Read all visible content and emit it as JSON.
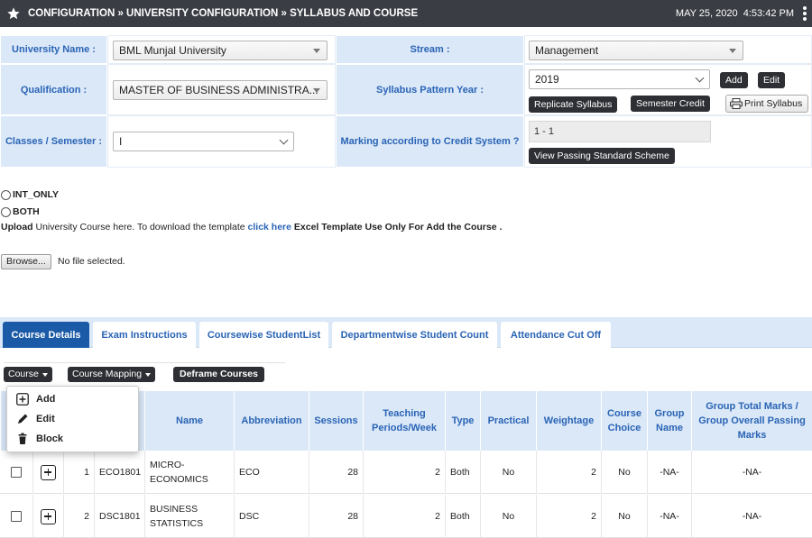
{
  "header": {
    "breadcrumb": "CONFIGURATION » UNIVERSITY CONFIGURATION » SYLLABUS AND COURSE",
    "date": "MAY 25, 2020",
    "time": "4:53:42 PM",
    "star_icon": "star-icon",
    "menu_icon": "kebab-menu-icon"
  },
  "form": {
    "university_label": "University Name :",
    "university_value": "BML Munjal University",
    "stream_label": "Stream :",
    "stream_value": "Management",
    "qualification_label": "Qualification :",
    "qualification_value": "MASTER OF BUSINESS ADMINISTRA...",
    "syllabus_year_label": "Syllabus Pattern Year :",
    "syllabus_year_value": "2019",
    "add_label": "Add",
    "edit_label": "Edit",
    "replicate_label": "Replicate Syllabus",
    "semester_credit_label": "Semester Credit",
    "print_label": "Print Syllabus",
    "classes_label": "Classes / Semester :",
    "classes_value": "I",
    "marking_label": "Marking according to Credit System ?",
    "marking_value": "1 - 1",
    "passing_label": "View Passing Standard Scheme"
  },
  "options": {
    "int_only": "INT_ONLY",
    "both": "BOTH",
    "upload_bold": "Upload",
    "upload_text": " University Course here. To download the template ",
    "click_here": "click here",
    "template_note": " Excel Template Use Only For Add the Course .",
    "browse_label": "Browse...",
    "no_file": "No file selected."
  },
  "tabs": [
    {
      "label": "Course Details"
    },
    {
      "label": "Exam Instructions"
    },
    {
      "label": "Coursewise StudentList"
    },
    {
      "label": "Departmentwise Student Count"
    },
    {
      "label": "Attendance Cut Off"
    }
  ],
  "toolbar": {
    "course_label": "Course",
    "mapping_label": "Course Mapping",
    "deframe_label": "Deframe Courses"
  },
  "course_menu": {
    "add": "Add",
    "edit": "Edit",
    "block": "Block"
  },
  "table": {
    "headers": {
      "name": "Name",
      "abbreviation": "Abbreviation",
      "sessions": "Sessions",
      "teaching": "Teaching Periods/Week",
      "type": "Type",
      "practical": "Practical",
      "weightage": "Weightage",
      "choice": "Course Choice",
      "group": "Group Name",
      "group_total": "Group Total Marks / Group Overall Passing Marks"
    },
    "rows": [
      {
        "no": "1",
        "code": "ECO1801",
        "name": "MICRO-ECONOMICS",
        "abbr": "ECO",
        "sessions": "28",
        "teaching": "2",
        "type": "Both",
        "practical": "No",
        "weightage": "2",
        "choice": "No",
        "group": "-NA-",
        "group_total": "-NA-"
      },
      {
        "no": "2",
        "code": "DSC1801",
        "name": "BUSINESS STATISTICS",
        "abbr": "DSC",
        "sessions": "28",
        "teaching": "2",
        "type": "Both",
        "practical": "No",
        "weightage": "2",
        "choice": "No",
        "group": "-NA-",
        "group_total": "-NA-"
      }
    ]
  },
  "colors": {
    "header_bg": "#3a3d44",
    "label_bg": "#dbe8f8",
    "label_text": "#2a64b5",
    "active_tab": "#1b5aa6",
    "dark_button": "#2d2f34"
  }
}
